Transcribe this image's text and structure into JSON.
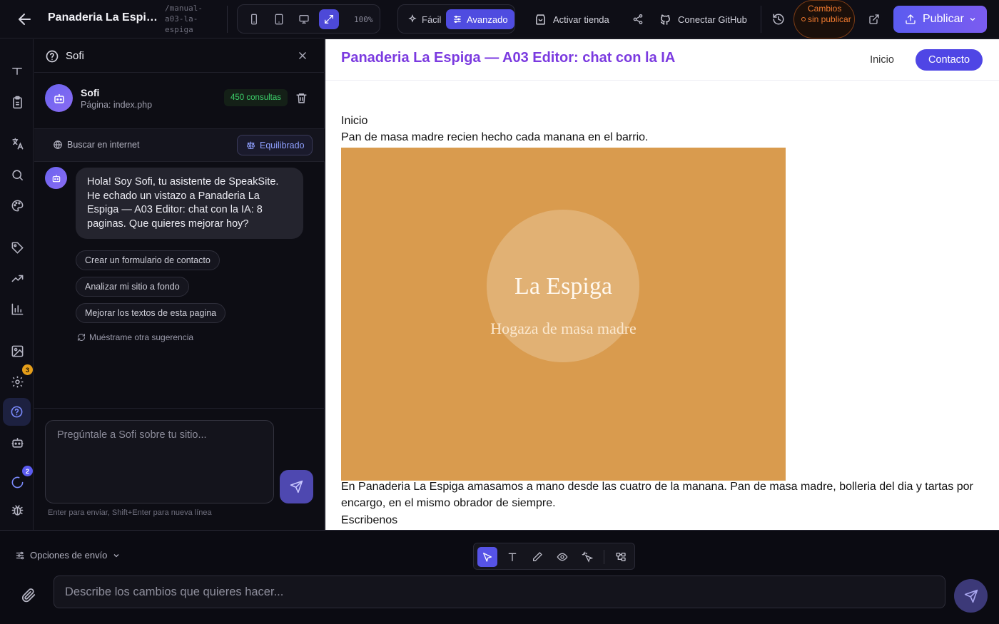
{
  "topbar": {
    "site_title": "Panaderia La Espiga...",
    "slug": "/manual-a03-la-espiga",
    "zoom": "100%",
    "mode_easy": "Fácil",
    "mode_advanced": "Avanzado",
    "activate_store": "Activar tienda",
    "connect_github": "Conectar GitHub",
    "unpublished": "Cambios sin publicar",
    "publish": "Publicar"
  },
  "rail": {
    "settings_badge": "3",
    "loader_badge": "2"
  },
  "chat": {
    "header_title": "Sofi",
    "bot_name": "Sofi",
    "bot_page": "Página: index.php",
    "consultations": "450 consultas",
    "search_web": "Buscar en internet",
    "mode": "Equilibrado",
    "greeting": "Hola! Soy Sofi, tu asistente de SpeakSite. He echado un vistazo a Panaderia La Espiga — A03 Editor: chat con la IA: 8 paginas. Que quieres mejorar hoy?",
    "suggestions": [
      "Crear un formulario de contacto",
      "Analizar mi sitio a fondo",
      "Mejorar los textos de esta pagina"
    ],
    "more_suggestions": "Muéstrame otra sugerencia",
    "input_placeholder": "Pregúntale a Sofi sobre tu sitio...",
    "hint": "Enter para enviar, Shift+Enter para nueva línea"
  },
  "preview": {
    "site_title": "Panaderia La Espiga — A03 Editor: chat con la IA",
    "nav": [
      "Inicio",
      "Contacto"
    ],
    "heading": "Inicio",
    "tagline": "Pan de masa madre recien hecho cada manana en el barrio.",
    "hero_title": "La Espiga",
    "hero_subtitle": "Hogaza de masa madre",
    "body": "En Panaderia La Espiga amasamos a mano desde las cuatro de la manana. Pan de masa madre, bolleria del dia y tartas por encargo, en el mismo obrador de siempre.",
    "contact_heading": "Escribenos"
  },
  "bottom": {
    "send_options": "Opciones de envío",
    "input_placeholder": "Describe los cambios que quieres hacer..."
  },
  "colors": {
    "accent": "#5653e6",
    "preview_title": "#7b3ae0",
    "hero_bg": "#d99b4e",
    "unpublished": "#f07a2f",
    "consult_badge": "#3ccf6a"
  }
}
